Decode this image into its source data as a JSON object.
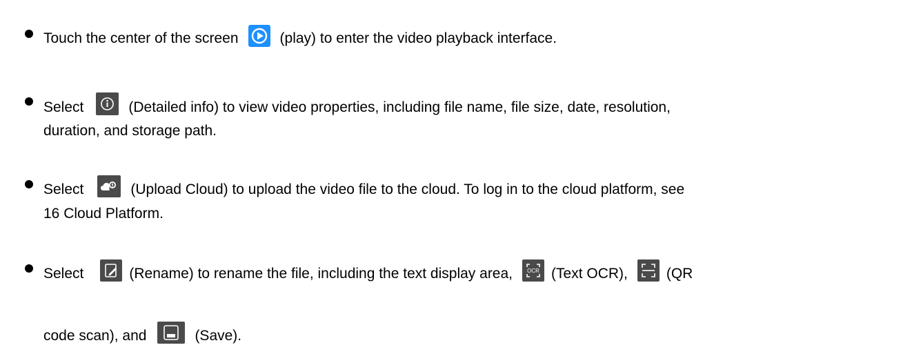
{
  "items": [
    {
      "line1": {
        "a": "Touch the center of the screen",
        "b": "(play) to enter the video playback interface."
      },
      "icon": "play-icon"
    },
    {
      "line1": {
        "a": "Select",
        "b": "(Detailed info) to view video properties, including file name, file size, date, resolution,"
      },
      "line2": "duration, and storage path.",
      "icon": "info-icon"
    },
    {
      "line1": {
        "a": "Select",
        "b": "(Upload Cloud) to upload the video file to the cloud. To log in to the cloud platform, see"
      },
      "line2": "16 Cloud Platform.",
      "icon": "upload-cloud-icon"
    },
    {
      "line1": {
        "a": "Select",
        "b": "(Rename) to rename the file, including the text display area,",
        "c": "(Text OCR),",
        "d": "(QR"
      },
      "line2": {
        "a": "code scan), and",
        "b": "(Save)."
      },
      "icons": [
        "rename-icon",
        "ocr-icon",
        "qr-scan-icon",
        "save-icon"
      ]
    }
  ],
  "colors": {
    "text": "#000000",
    "play_icon_blue": "#1e90ff",
    "dark_icon_bg": "#4a4a4a"
  }
}
